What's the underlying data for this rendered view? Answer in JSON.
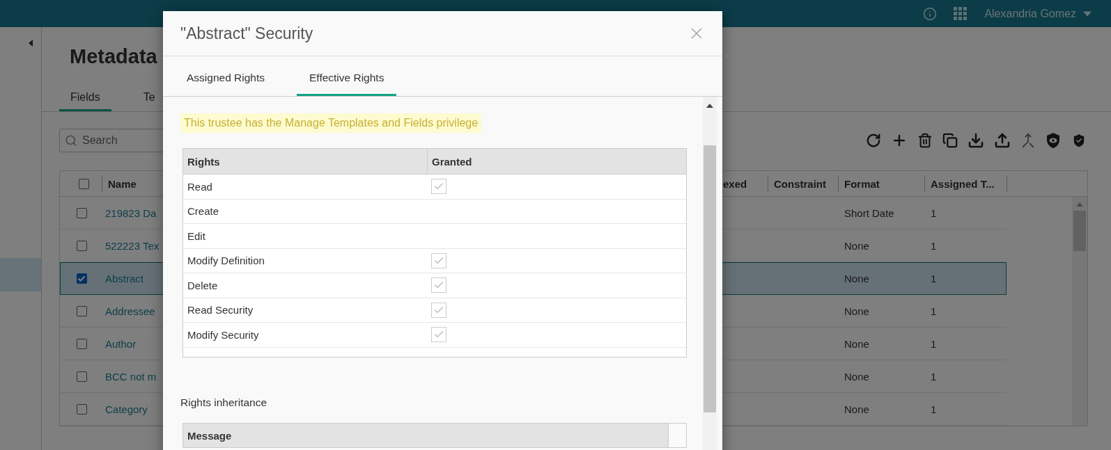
{
  "top_bar": {
    "user_name": "Alexandria Gomez"
  },
  "page": {
    "title": "Metadata",
    "tabs": [
      {
        "label": "Fields",
        "selected": true
      },
      {
        "label": "Te",
        "selected": false
      }
    ],
    "search": {
      "placeholder": "Search"
    }
  },
  "fields_table": {
    "header_checked": false,
    "columns": [
      "Name",
      "exed",
      "Constraint",
      "Format",
      "Assigned T..."
    ],
    "rows": [
      {
        "name": "219823 Da",
        "format": "Short Date",
        "assigned": "1",
        "checked": false,
        "selected": false
      },
      {
        "name": "522223 Tex",
        "format": "None",
        "assigned": "1",
        "checked": false,
        "selected": false
      },
      {
        "name": "Abstract",
        "format": "None",
        "assigned": "1",
        "checked": true,
        "selected": true
      },
      {
        "name": "Addressee",
        "format": "None",
        "assigned": "1",
        "checked": false,
        "selected": false
      },
      {
        "name": "Author",
        "format": "None",
        "assigned": "1",
        "checked": false,
        "selected": false
      },
      {
        "name": "BCC not m",
        "format": "None",
        "assigned": "1",
        "checked": false,
        "selected": false
      },
      {
        "name": "Category",
        "format": "None",
        "assigned": "1",
        "checked": false,
        "selected": false
      }
    ]
  },
  "dialog": {
    "title": "\"Abstract\" Security",
    "tabs": [
      {
        "label": "Assigned Rights",
        "selected": false
      },
      {
        "label": "Effective Rights",
        "selected": true
      }
    ],
    "notice": "This trustee has the Manage Templates and Fields privilege",
    "rights_table": {
      "columns": [
        "Rights",
        "Granted"
      ],
      "rows": [
        {
          "name": "Read",
          "granted": true
        },
        {
          "name": "Create",
          "granted": false
        },
        {
          "name": "Edit",
          "granted": false
        },
        {
          "name": "Modify Definition",
          "granted": true
        },
        {
          "name": "Delete",
          "granted": true
        },
        {
          "name": "Read Security",
          "granted": true
        },
        {
          "name": "Modify Security",
          "granted": true
        }
      ]
    },
    "inheritance": {
      "label": "Rights inheritance",
      "columns": [
        "Message"
      ]
    }
  }
}
